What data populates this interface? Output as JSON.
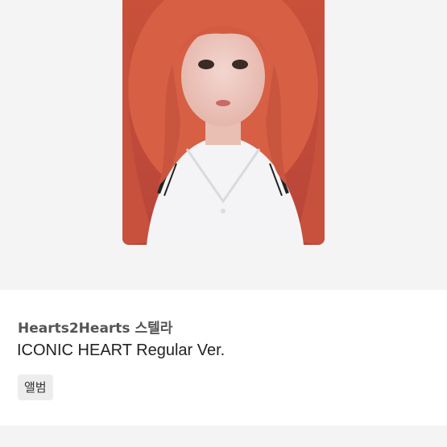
{
  "product": {
    "artist_line": "Hearts2Hearts 스텔라",
    "title": "ICONIC HEART Regular Ver.",
    "tag": "앨범"
  },
  "image": {
    "alt": "photocard"
  },
  "colors": {
    "image_background": "#f4f4f4",
    "hair": "#d8664a",
    "tag_background": "#ededed"
  }
}
